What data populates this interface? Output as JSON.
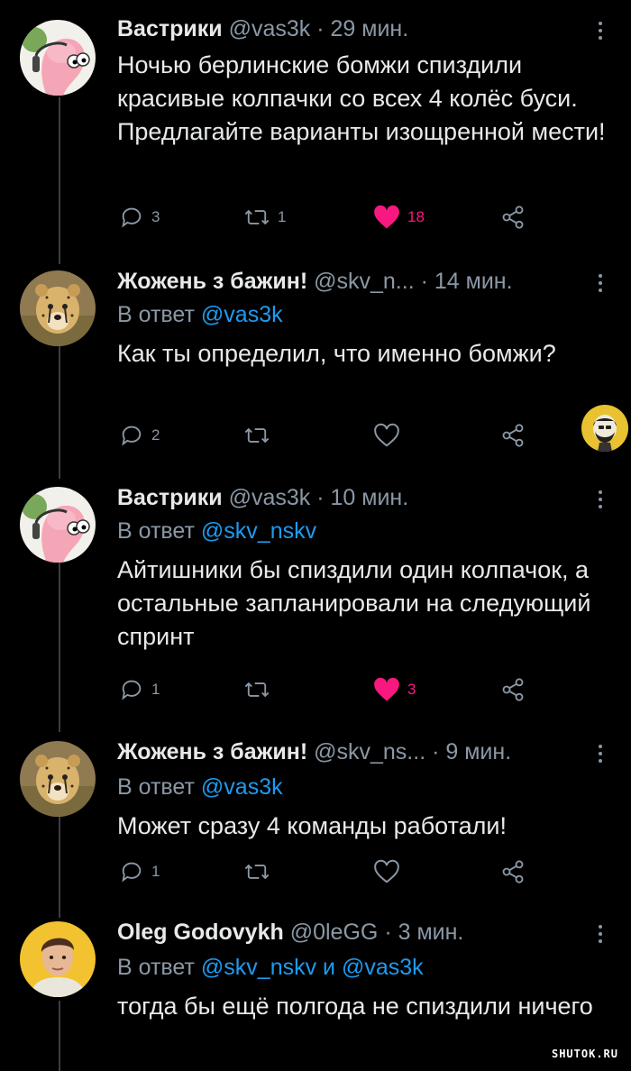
{
  "tweets": [
    {
      "name": "Вастрики",
      "handle": "@vas3k",
      "time": "29 мин.",
      "reply_prefix": "",
      "reply_mention": "",
      "reply_sep": "",
      "reply_mention2": "",
      "text": "Ночью берлинские бомжи спиздили красивые колпачки со всех 4 колёс буси. Предлагайте варианты изощренной мести!",
      "replies": "3",
      "retweets": "1",
      "likes": "18",
      "liked": true
    },
    {
      "name": "Жожень з бажин!",
      "handle": "@skv_n...",
      "time": "14 мин.",
      "reply_prefix": "В ответ",
      "reply_mention": "@vas3k",
      "reply_sep": "",
      "reply_mention2": "",
      "text": "Как ты определил, что именно бомжи?",
      "replies": "2",
      "retweets": "",
      "likes": "",
      "liked": false
    },
    {
      "name": "Вастрики",
      "handle": "@vas3k",
      "time": "10 мин.",
      "reply_prefix": "В ответ",
      "reply_mention": "@skv_nskv",
      "reply_sep": "",
      "reply_mention2": "",
      "text": "Айтишники бы спиздили один колпачок, а остальные запланировали на следующий спринт",
      "replies": "1",
      "retweets": "",
      "likes": "3",
      "liked": true
    },
    {
      "name": "Жожень з бажин!",
      "handle": "@skv_ns...",
      "time": "9 мин.",
      "reply_prefix": "В ответ",
      "reply_mention": "@vas3k",
      "reply_sep": "",
      "reply_mention2": "",
      "text": "Может сразу 4 команды работали!",
      "replies": "1",
      "retweets": "",
      "likes": "",
      "liked": false
    },
    {
      "name": "Oleg Godovykh",
      "handle": "@0leGG",
      "time": "3 мин.",
      "reply_prefix": "В ответ",
      "reply_mention": "@skv_nskv",
      "reply_sep": "и",
      "reply_mention2": "@vas3k",
      "text": "тогда бы ещё полгода не спиздили ничего"
    }
  ],
  "watermark": "SHUTOK.RU",
  "icons": {
    "reply": "reply-icon",
    "retweet": "retweet-icon",
    "like": "heart-icon",
    "share": "share-icon",
    "more": "more-icon"
  },
  "colors": {
    "background": "#000000",
    "text": "#e7e9ea",
    "muted": "#8b98a5",
    "mention": "#1d9bf0",
    "like": "#f91880"
  }
}
